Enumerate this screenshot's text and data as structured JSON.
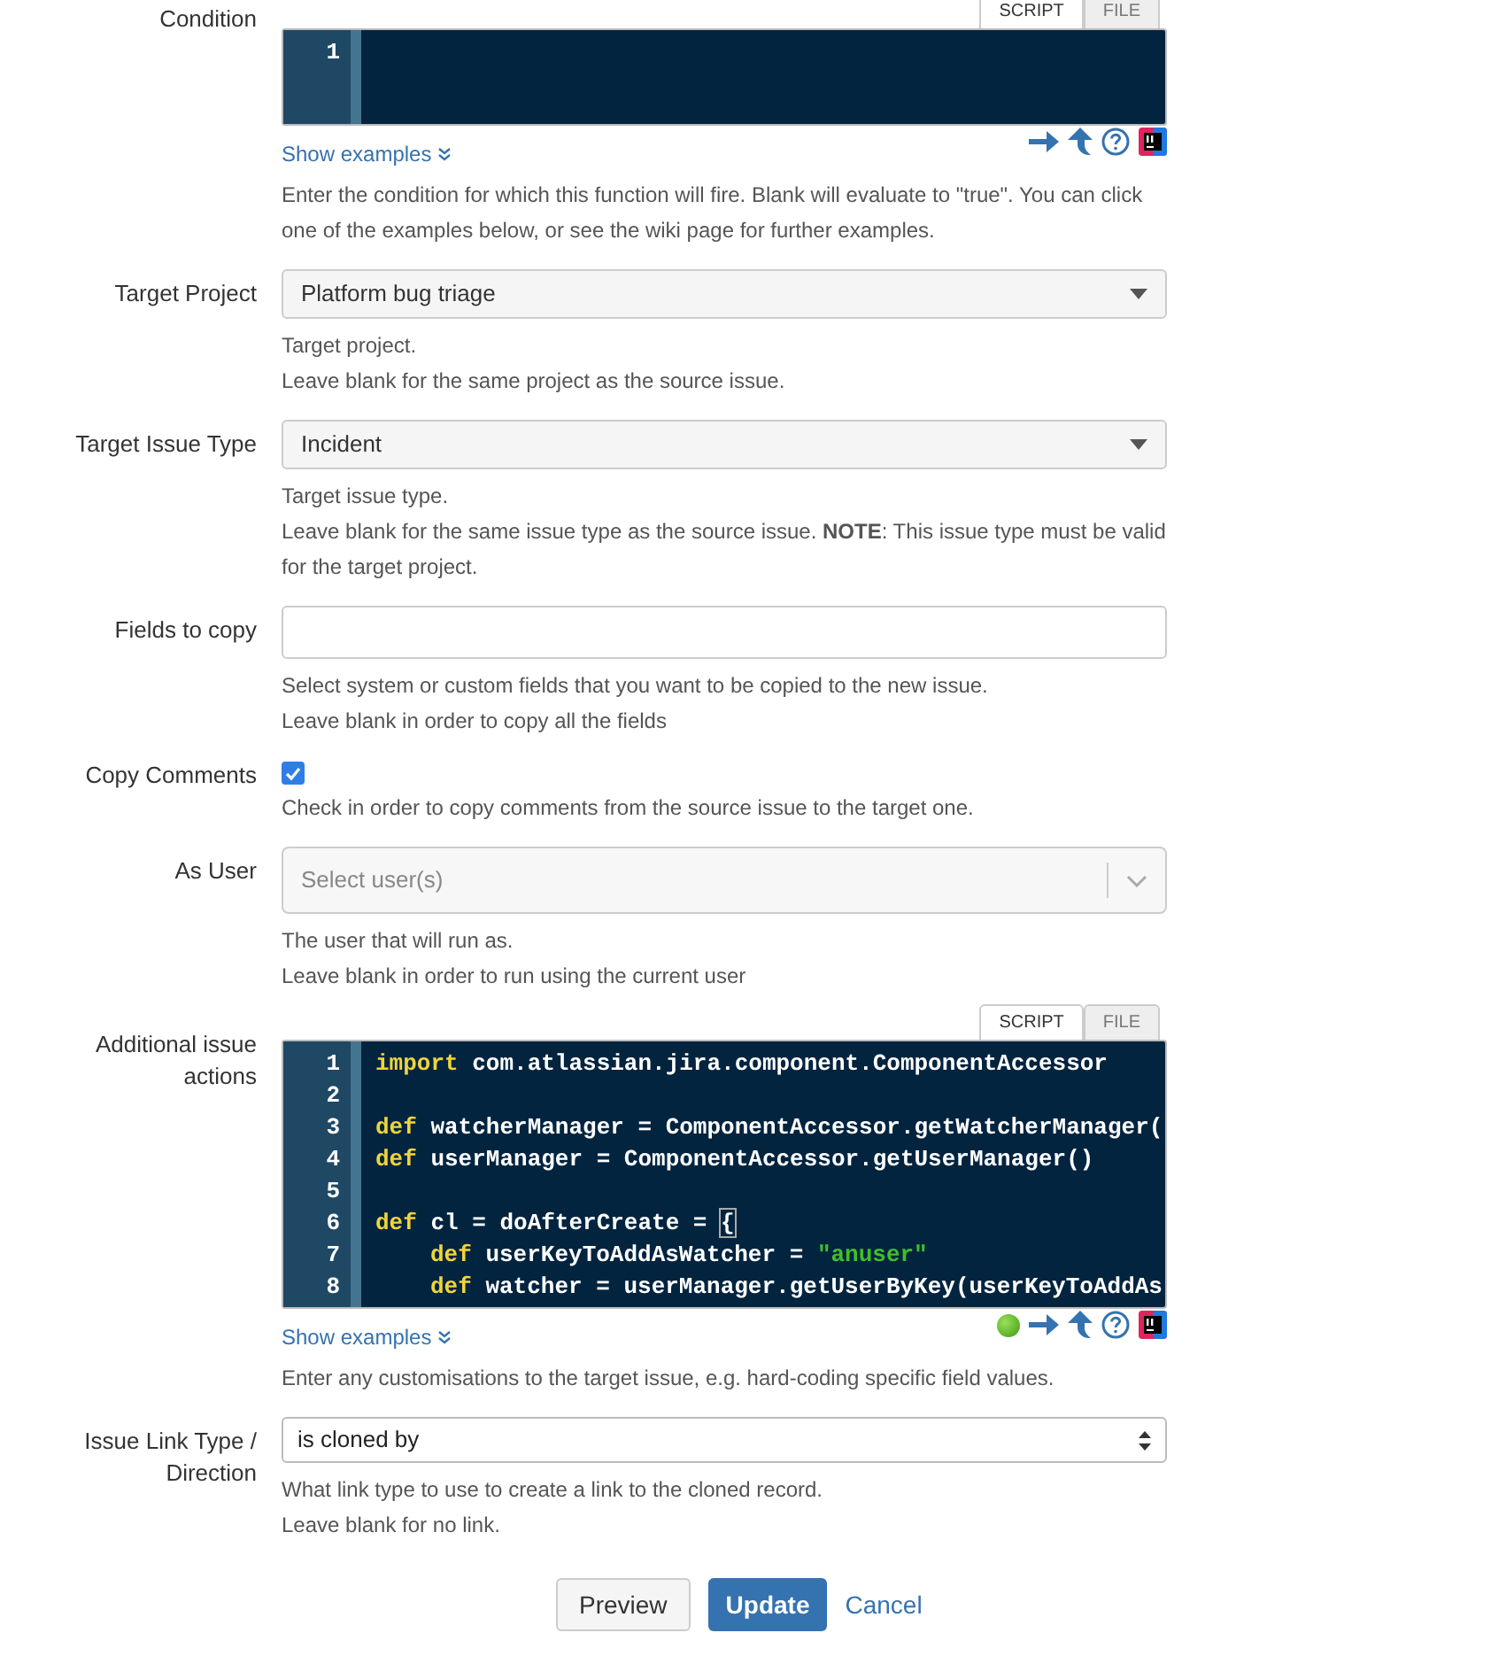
{
  "fields": [
    {
      "kind": "code",
      "label": "Condition",
      "tabs": [
        {
          "label": "SCRIPT",
          "selected": true
        },
        {
          "label": "FILE",
          "selected": false
        }
      ],
      "lines": [
        {
          "number": "1"
        }
      ],
      "link": "Show examples",
      "help": [
        "Enter the condition for which this function will fire. Blank will evaluate to \"true\". You can click one of the examples below, or see the wiki page for further examples."
      ]
    },
    {
      "kind": "select",
      "label": "Target Project",
      "value": "Platform bug triage",
      "help": [
        "Target project.",
        "Leave blank for the same project as the source issue."
      ]
    },
    {
      "kind": "select",
      "label": "Target Issue Type",
      "value": "Incident",
      "help": [
        "Target issue type.",
        "Leave blank for the same issue type as the source issue. **NOTE**: This issue type must be valid for the target project."
      ]
    },
    {
      "kind": "text",
      "label": "Fields to copy",
      "help": [
        "Select system or custom fields that you want to be copied to the new issue.",
        "Leave blank in order to copy all the fields"
      ]
    },
    {
      "kind": "checkbox",
      "label": "Copy Comments",
      "checked": true,
      "help": [
        "Check in order to copy comments from the source issue to the target one."
      ]
    },
    {
      "kind": "user_select",
      "label": "As User",
      "placeholder": "Select user(s)",
      "help": [
        "The user that will run as.",
        "Leave blank in order to run using the current user"
      ]
    },
    {
      "kind": "code",
      "label": "Additional issue actions",
      "tabs": [
        {
          "label": "SCRIPT",
          "selected": true
        },
        {
          "label": "FILE",
          "selected": false
        }
      ],
      "valid": true,
      "lines": [
        {
          "number": "1",
          "tokens": [
            {
              "kind": "keyword",
              "text": "import"
            },
            {
              "kind": "plain",
              "text": " com.atlassian.jira.component.ComponentAccessor"
            }
          ]
        },
        {
          "number": "2"
        },
        {
          "number": "3",
          "tokens": [
            {
              "kind": "keyword",
              "text": "def"
            },
            {
              "kind": "plain",
              "text": " watcherManager = ComponentAccessor.getWatcherManager("
            }
          ]
        },
        {
          "number": "4",
          "tokens": [
            {
              "kind": "keyword",
              "text": "def"
            },
            {
              "kind": "plain",
              "text": " userManager = ComponentAccessor.getUserManager()"
            }
          ]
        },
        {
          "number": "5"
        },
        {
          "number": "6",
          "tokens": [
            {
              "kind": "keyword",
              "text": "def"
            },
            {
              "kind": "plain",
              "text": " cl = doAfterCreate = "
            },
            {
              "kind": "matched_bracket",
              "text": "{"
            }
          ]
        },
        {
          "number": "7",
          "indented": true,
          "tokens": [
            {
              "kind": "keyword",
              "text": "def"
            },
            {
              "kind": "plain",
              "text": " userKeyToAddAsWatcher = "
            },
            {
              "kind": "string",
              "text": "\"anuser\""
            }
          ]
        },
        {
          "number": "8",
          "indented": true,
          "tokens": [
            {
              "kind": "keyword",
              "text": "def"
            },
            {
              "kind": "plain",
              "text": " watcher = userManager.getUserByKey(userKeyToAddAs"
            }
          ]
        }
      ],
      "link": "Show examples",
      "help": [
        "Enter any customisations to the target issue, e.g. hard-coding specific field values."
      ]
    },
    {
      "kind": "native_select",
      "label": "Issue Link Type / Direction",
      "value": "is cloned by",
      "help": [
        "What link type to use to create a link to the cloned record.",
        "Leave blank for no link."
      ]
    }
  ],
  "buttons": [
    {
      "kind": "secondary",
      "label": "Preview"
    },
    {
      "kind": "primary",
      "label": "Update"
    },
    {
      "kind": "link",
      "label": "Cancel"
    }
  ]
}
